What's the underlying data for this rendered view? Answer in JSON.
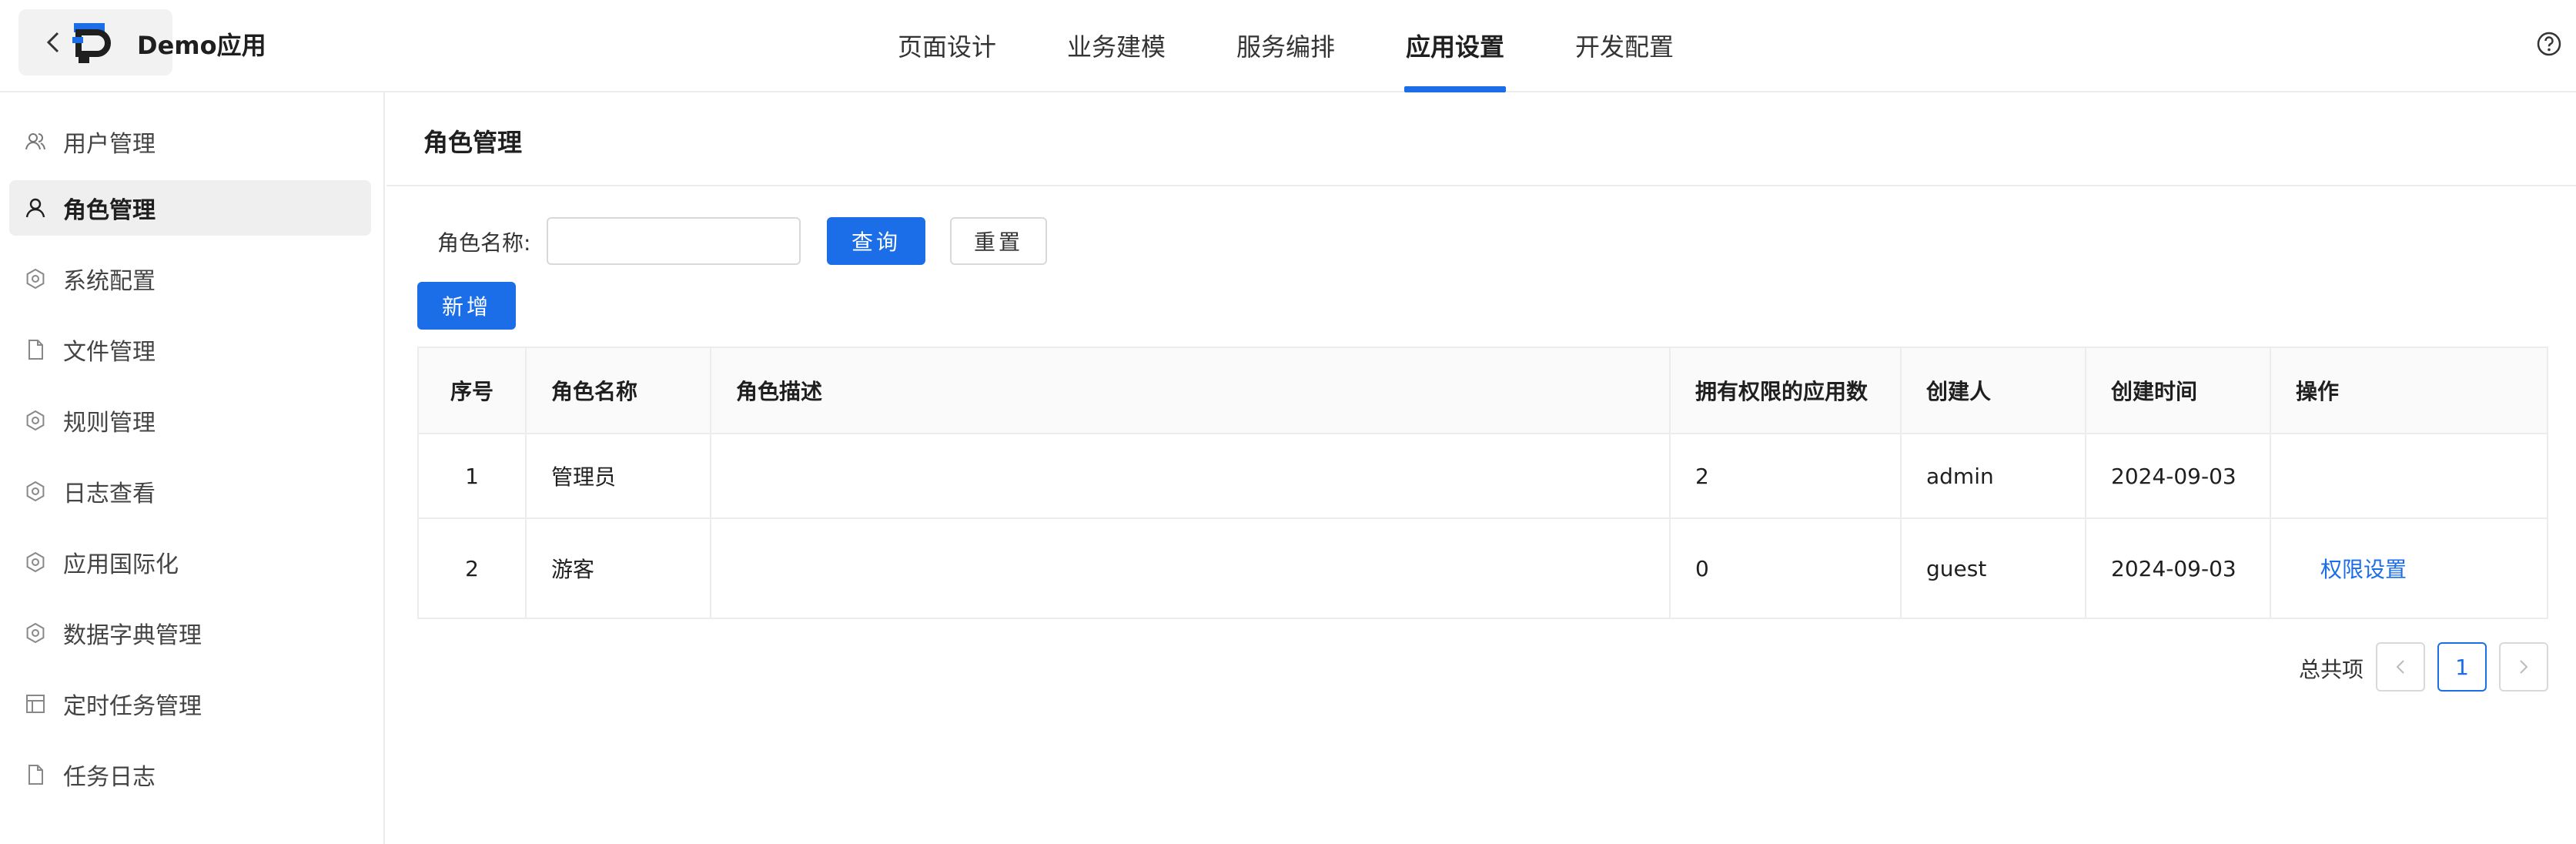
{
  "header": {
    "app_title": "Demo应用",
    "tabs": [
      {
        "label": "页面设计"
      },
      {
        "label": "业务建模"
      },
      {
        "label": "服务编排"
      },
      {
        "label": "应用设置",
        "active": true
      },
      {
        "label": "开发配置"
      }
    ]
  },
  "sidebar": {
    "items": [
      {
        "label": "用户管理",
        "icon": "users-icon"
      },
      {
        "label": "角色管理",
        "icon": "user-icon",
        "active": true
      },
      {
        "label": "系统配置",
        "icon": "gear-icon"
      },
      {
        "label": "文件管理",
        "icon": "file-icon"
      },
      {
        "label": "规则管理",
        "icon": "gear-icon"
      },
      {
        "label": "日志查看",
        "icon": "gear-icon"
      },
      {
        "label": "应用国际化",
        "icon": "gear-icon"
      },
      {
        "label": "数据字典管理",
        "icon": "gear-icon"
      },
      {
        "label": "定时任务管理",
        "icon": "layout-icon"
      },
      {
        "label": "任务日志",
        "icon": "file-icon"
      }
    ]
  },
  "main": {
    "title": "角色管理",
    "search": {
      "label": "角色名称:",
      "value": "",
      "query_label": "查询",
      "reset_label": "重置"
    },
    "add_label": "新增",
    "table": {
      "columns": [
        "序号",
        "角色名称",
        "角色描述",
        "拥有权限的应用数",
        "创建人",
        "创建时间",
        "操作"
      ],
      "rows": [
        {
          "index": "1",
          "name": "管理员",
          "desc": "",
          "app_count": "2",
          "creator": "admin",
          "created": "2024-09-03",
          "action": ""
        },
        {
          "index": "2",
          "name": "游客",
          "desc": "",
          "app_count": "0",
          "creator": "guest",
          "created": "2024-09-03",
          "action": "权限设置"
        }
      ]
    },
    "pagination": {
      "total_label": "总共项",
      "current_page": "1",
      "prev": "<",
      "next": ">"
    }
  },
  "colors": {
    "accent": "#1b6ee8",
    "border": "#ececec",
    "active_bg": "#efefef"
  }
}
